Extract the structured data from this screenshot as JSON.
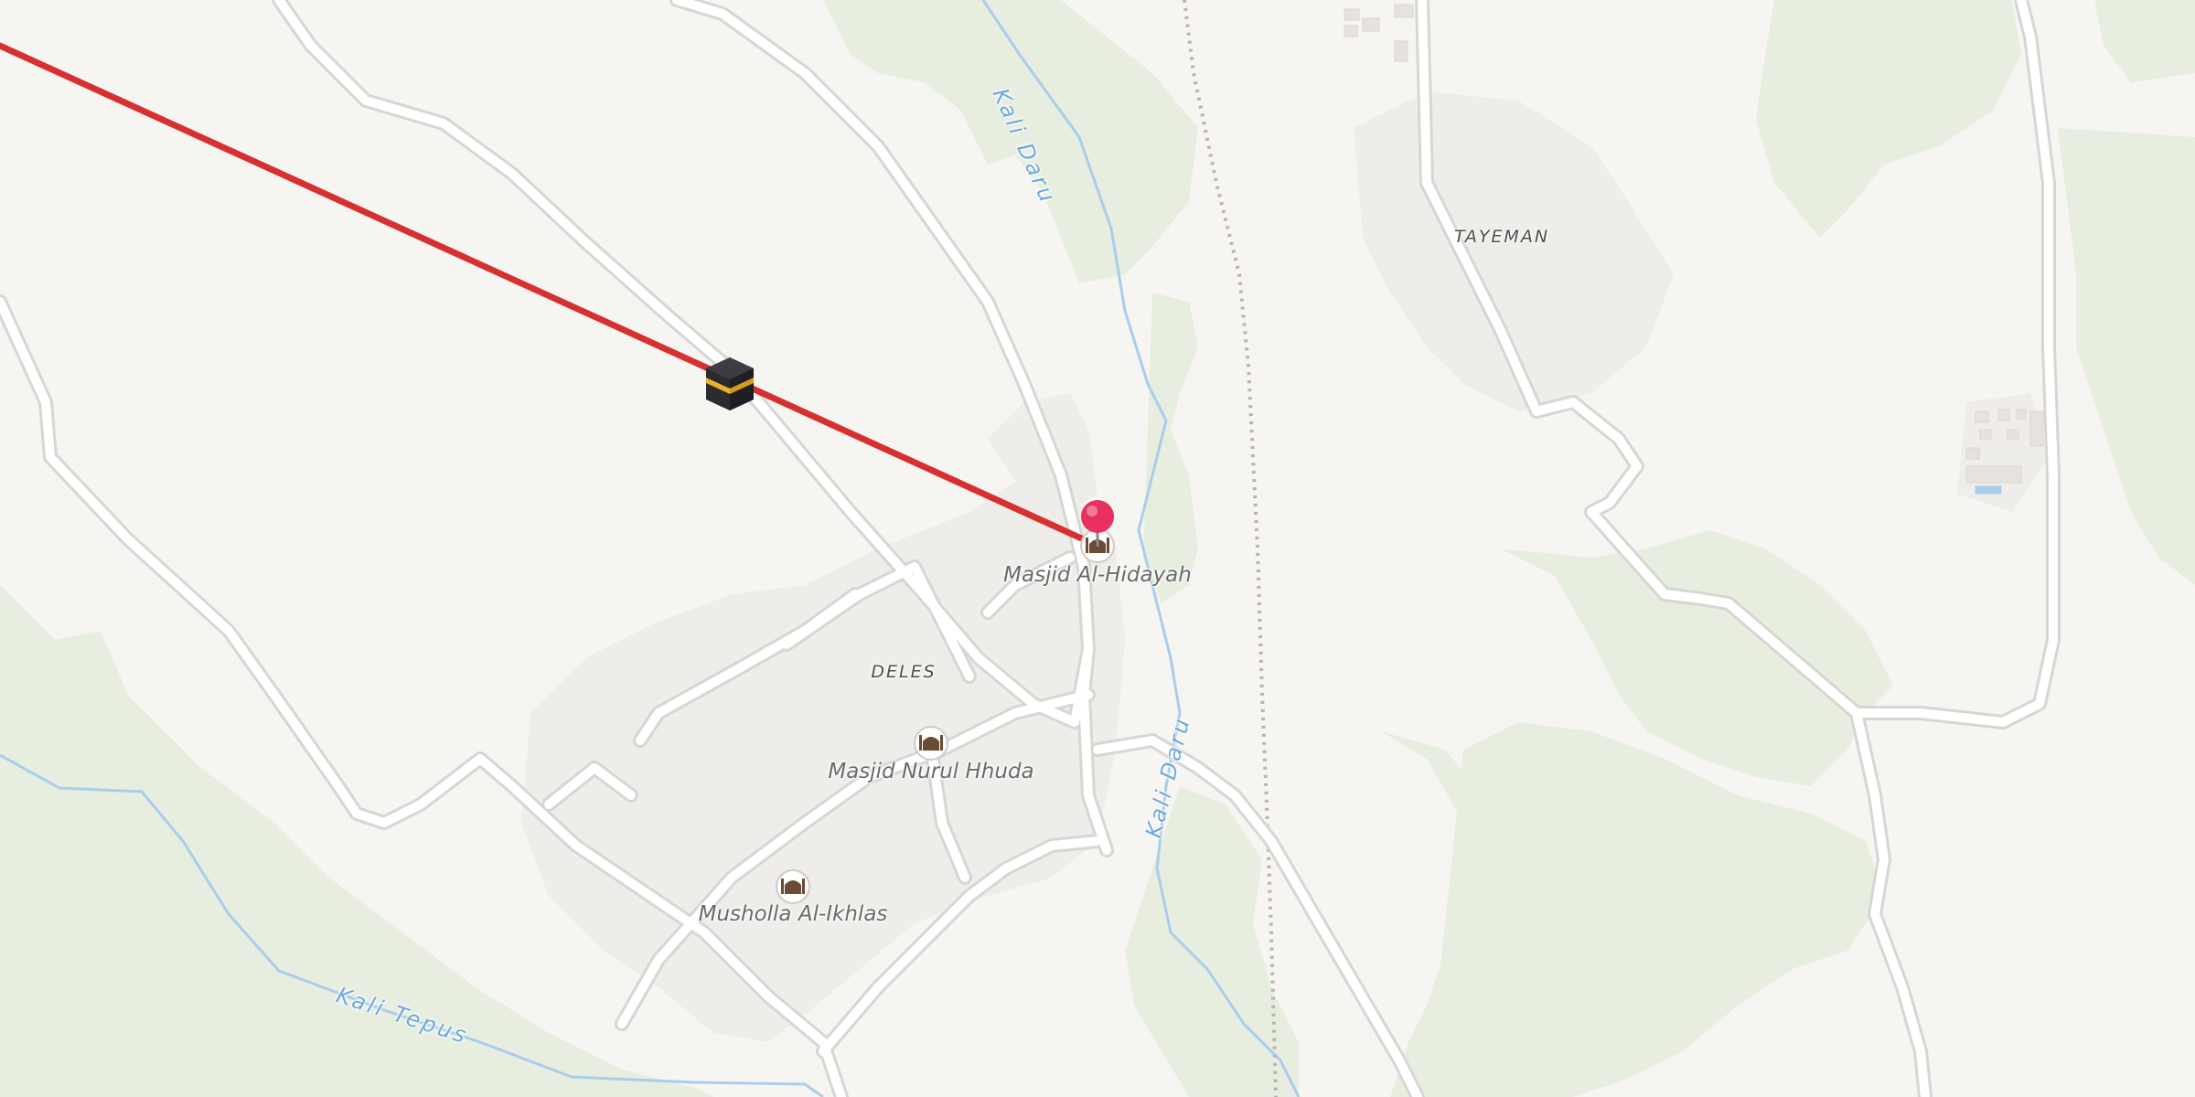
{
  "map": {
    "places": [
      {
        "id": "tayeman",
        "name": "TAYEMAN"
      },
      {
        "id": "deles",
        "name": "DELES"
      }
    ],
    "pois": [
      {
        "id": "masjid-al-hidayah",
        "name": "Masjid Al-Hidayah",
        "icon": "mosque-icon"
      },
      {
        "id": "masjid-nurul-hhuda",
        "name": "Masjid Nurul Hhuda",
        "icon": "mosque-icon"
      },
      {
        "id": "musholla-al-ikhlas",
        "name": "Musholla Al-Ikhlas",
        "icon": "mosque-icon"
      }
    ],
    "waterways": [
      {
        "id": "kali-daru",
        "name": "Kali Daru"
      },
      {
        "id": "kali-tepus",
        "name": "Kali Tepus"
      }
    ],
    "markers": {
      "location_pin": {
        "icon": "map-pin-icon",
        "color": "#e8315e"
      },
      "qibla_target": {
        "icon": "kaaba-icon"
      },
      "qibla_line": {
        "color": "#d63031"
      }
    },
    "colors": {
      "background": "#f7f5f2",
      "forest": "#e7eee0",
      "residential": "#efedea",
      "road_fill": "#ffffff",
      "road_casing": "#d8d6d2",
      "river": "#a9cdeb",
      "rail": "#a8a4a0"
    }
  }
}
